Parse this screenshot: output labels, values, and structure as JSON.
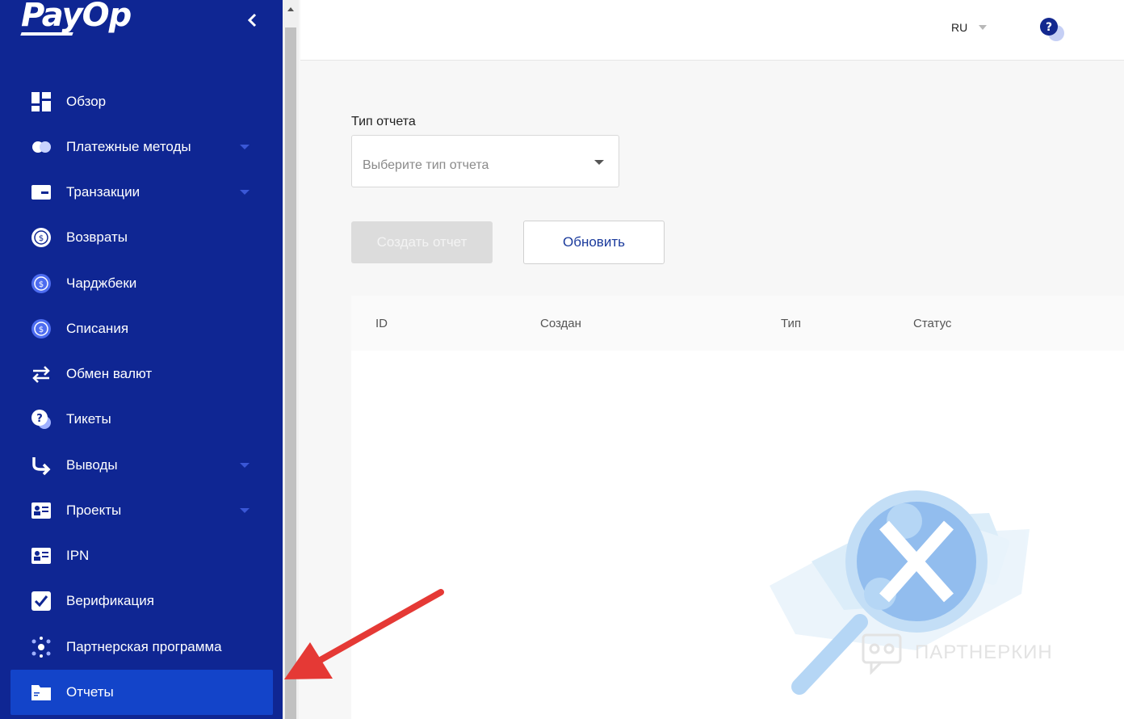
{
  "brand": {
    "logo_text": "PayOp"
  },
  "sidebar": {
    "items": [
      {
        "label": "Обзор",
        "icon": "dashboard-icon",
        "has_submenu": false
      },
      {
        "label": "Платежные методы",
        "icon": "payment-methods-icon",
        "has_submenu": true
      },
      {
        "label": "Транзакции",
        "icon": "card-icon",
        "has_submenu": true
      },
      {
        "label": "Возвраты",
        "icon": "refund-icon",
        "has_submenu": false
      },
      {
        "label": "Чарджбеки",
        "icon": "chargeback-icon",
        "has_submenu": false
      },
      {
        "label": "Списания",
        "icon": "writeoff-icon",
        "has_submenu": false
      },
      {
        "label": "Обмен валют",
        "icon": "exchange-icon",
        "has_submenu": false
      },
      {
        "label": "Тикеты",
        "icon": "tickets-icon",
        "has_submenu": false
      },
      {
        "label": "Выводы",
        "icon": "withdrawal-icon",
        "has_submenu": true
      },
      {
        "label": "Проекты",
        "icon": "projects-icon",
        "has_submenu": true
      },
      {
        "label": "IPN",
        "icon": "ipn-icon",
        "has_submenu": false
      },
      {
        "label": "Верификация",
        "icon": "verification-icon",
        "has_submenu": false
      },
      {
        "label": "Партнерская программа",
        "icon": "affiliate-icon",
        "has_submenu": false
      },
      {
        "label": "Отчеты",
        "icon": "reports-folder-icon",
        "has_submenu": false,
        "active": true
      }
    ]
  },
  "header": {
    "language": "RU"
  },
  "report": {
    "type_label": "Тип отчета",
    "type_placeholder": "Выберите тип отчета",
    "create_label": "Создать отчет",
    "refresh_label": "Обновить"
  },
  "table": {
    "columns": [
      "ID",
      "Создан",
      "Тип",
      "Статус"
    ]
  },
  "watermark": {
    "text": "ПАРТНЕРКИН"
  },
  "colors": {
    "sidebar": "#0f2693",
    "active_item": "#1344c9",
    "accent_caret": "#3a57d6",
    "refresh_text": "#1a3a9c",
    "annotation_arrow": "#e53935"
  }
}
